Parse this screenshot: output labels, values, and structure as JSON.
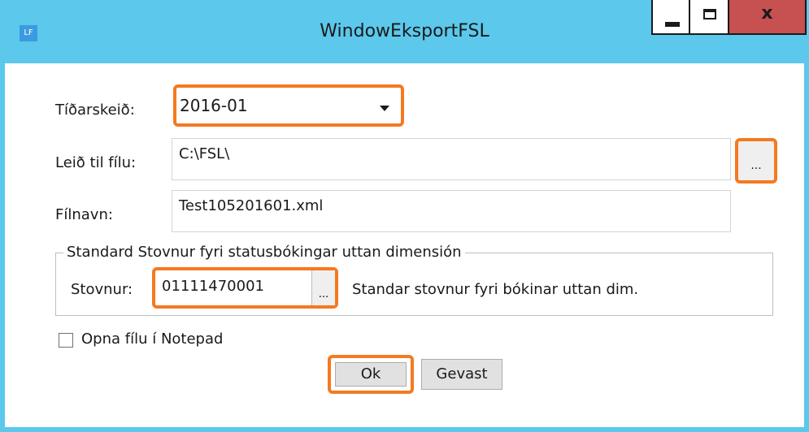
{
  "window": {
    "app_icon": "LF",
    "title": "WindowEksportFSL",
    "minimize_icon": "minimize-icon",
    "maximize_icon": "maximize-icon",
    "close_label": "x"
  },
  "form": {
    "period_label": "Tíðarskeið:",
    "period_value": "2016-01",
    "path_label": "Leið til fílu:",
    "path_value": "C:\\FSL\\",
    "browse_label": "...",
    "filename_label": "Fílnavn:",
    "filename_value": "Test105201601.xml"
  },
  "group": {
    "legend": "Standard Stovnur fyri statusbókingar uttan dimensión",
    "stovnur_label": "Stovnur:",
    "stovnur_value": "01111470001",
    "browse_label": "...",
    "description": "Standar stovnur fyri bókinar uttan dim."
  },
  "options": {
    "open_notepad_label": "Opna fílu í Notepad",
    "open_notepad_checked": false
  },
  "buttons": {
    "ok_label": "Ok",
    "cancel_label": "Gevast"
  },
  "colors": {
    "titlebar": "#5bc8ec",
    "highlight": "#f47a20",
    "close_button": "#c75050"
  }
}
